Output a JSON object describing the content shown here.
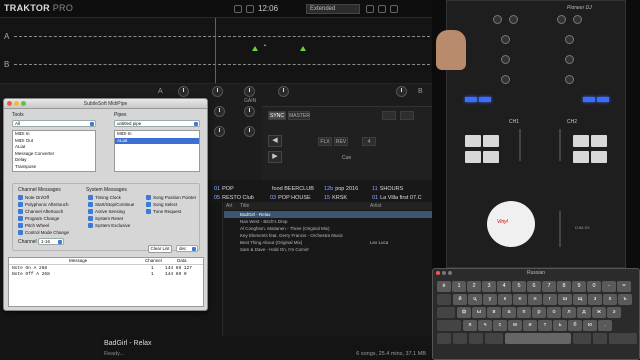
{
  "traktor": {
    "logo_main": "TRAKTOR",
    "logo_sub": "PRO",
    "clock": "12:06",
    "layout_select": "Extended",
    "deck_a_label": "A",
    "deck_b_label": "B",
    "mixer_deck_a": "A",
    "mixer_deck_b": "B",
    "gain_label": "GAIN",
    "deck_b_buttons": [
      "SYNC",
      "MASTER",
      "FLX",
      "REV"
    ],
    "cue_label": "Cue",
    "browser_favorites": [
      {
        "n": "01",
        "label": "POP"
      },
      {
        "n": "05",
        "label": "RESTO Club"
      },
      {
        "n": "",
        "label": "food BEERCLUB"
      },
      {
        "n": "03",
        "label": "POP HOUSE"
      },
      {
        "n": "12b",
        "label": "pop 2016"
      },
      {
        "n": "15",
        "label": "KRSK"
      },
      {
        "n": "11",
        "label": "SHOURS"
      },
      {
        "n": "01",
        "label": "La Villa first 07.C"
      }
    ],
    "track_columns": {
      "art": "Art",
      "title": "Title",
      "artist": "Artist"
    },
    "tracks": [
      {
        "title": "BadGirl - Relax",
        "artist": ""
      },
      {
        "title": "Nas West - Bitch's Drop",
        "artist": ""
      },
      {
        "title": "Al Conghton, Maitanen - Three (Original Mix)",
        "artist": ""
      },
      {
        "title": "Key Elements feat. Gerry Francis - Orchestra Music",
        "artist": ""
      },
      {
        "title": "Best Thing About (Original Mix)",
        "artist": "Lex Luca"
      },
      {
        "title": "Sam & Dave - Hold On, I'm Comin'",
        "artist": ""
      }
    ],
    "now_playing": "BadGirl - Relax",
    "status": "Ready...",
    "status_info": "6 songs, 25.4 mins, 37.1 MB"
  },
  "midipipe": {
    "title": "SubtleSoft MidiPipe",
    "tools_label": "Tools",
    "tools_filter": "All",
    "tools": [
      "MIDI In",
      "MIDI Out",
      "ALiat",
      "Message Converter",
      "Delay",
      "Transpose"
    ],
    "pipes_label": "Pipes",
    "pipes_select": "untitled pipe",
    "pipes": [
      "MIDI In",
      "ALiat"
    ],
    "channel_messages_label": "Channel Messages",
    "channel_messages": [
      "Note On/Off",
      "Polyphonic Aftertouch",
      "Channel Aftertouch",
      "Program Change",
      "Pitch Wheel",
      "Control Mode Change"
    ],
    "system_messages_label": "System Messages",
    "system_messages": [
      "Timing Clock",
      "Start/Stop/Continue",
      "Active Sensing",
      "System Reset",
      "System Exclusive"
    ],
    "system_messages_right": [
      "Song Position Pointer",
      "Song Select",
      "Tune Request"
    ],
    "channel_label": "Channel",
    "channel_value": "1-16",
    "clear_list": "Clear List",
    "hex_select": "dec",
    "table_headers": {
      "message": "Message",
      "channel": "Channel",
      "data": "Data"
    },
    "log": [
      {
        "message": "Note On  A 268",
        "channel": "1",
        "data": "144 69 127"
      },
      {
        "message": "Note Off A 268",
        "channel": "1",
        "data": "144 69 0"
      }
    ]
  },
  "hardware": {
    "brand": "Pioneer DJ",
    "ch1": "CH1",
    "ch2": "CH2",
    "model": "DJM-S9",
    "sticker": "Vinyl"
  },
  "keyboard": {
    "title": "Russian",
    "rows": [
      [
        "ё",
        "1",
        "2",
        "3",
        "4",
        "5",
        "6",
        "7",
        "8",
        "9",
        "0",
        "-",
        "="
      ],
      [
        "й",
        "ц",
        "у",
        "к",
        "е",
        "н",
        "г",
        "ш",
        "щ",
        "з",
        "х",
        "ъ"
      ],
      [
        "ф",
        "ы",
        "в",
        "а",
        "п",
        "р",
        "о",
        "л",
        "д",
        "ж",
        "э"
      ],
      [
        "я",
        "ч",
        "с",
        "м",
        "и",
        "т",
        "ь",
        "б",
        "ю",
        "."
      ]
    ]
  }
}
